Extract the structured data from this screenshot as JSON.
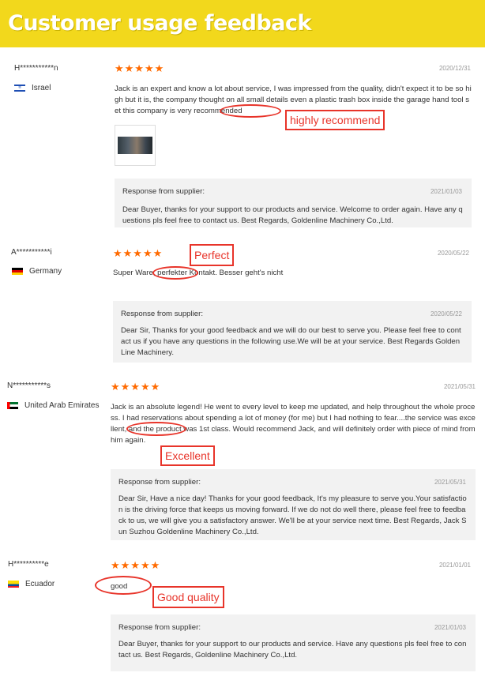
{
  "banner": {
    "title": "Customer usage feedback"
  },
  "stars": "★★★★★",
  "reviews": [
    {
      "user": "H***********n",
      "country": "Israel",
      "flag_icon": "israel-flag-icon",
      "date": "2020/12/31",
      "text": "Jack is an expert and know a lot about service, I was impressed from the quality, didn't expect it to be so high but it is, the company thought on all small details even a plastic trash box inside the garage hand tool set this company is very recommended",
      "annotation": "highly recommend",
      "response_title": "Response from supplier:",
      "response_date": "2021/01/03",
      "response_text": "Dear Buyer, thanks for your support to our products and service. Welcome to order again. Have any questions pls feel free to contact us. Best Regards, Goldenline Machinery Co.,Ltd."
    },
    {
      "user": "A***********i",
      "country": "Germany",
      "flag_icon": "germany-flag-icon",
      "date": "2020/05/22",
      "text": "Super Ware, perfekter Kontakt. Besser geht's nicht",
      "annotation": "Perfect",
      "response_title": "Response from supplier:",
      "response_date": "2020/05/22",
      "response_text": "Dear Sir,   Thanks for your good feedback and we will do our best to serve you. Please feel free to contact us if you have any questions in the following use.We will be at your service. Best Regards GoldenLine Machinery."
    },
    {
      "user": "N***********s",
      "country": "United Arab Emirates",
      "flag_icon": "uae-flag-icon",
      "date": "2021/05/31",
      "text": "Jack is an absolute legend! He went to every level to keep me updated, and help throughout the whole process. I had reservations about spending a lot of money (for me) but I had nothing to fear....the service was excellent, and the product was 1st class. Would recommend Jack, and will definitely order with piece of mind from him again.",
      "annotation": "Excellent",
      "response_title": "Response from supplier:",
      "response_date": "2021/05/31",
      "response_text": "Dear Sir, Have a nice day! Thanks for your good feedback, It's my pleasure to serve you.Your satisfaction is the driving force that keeps us moving forward. If we do not do well there, please feel free to feedback to us, we will give you a satisfactory answer. We'll be at your service next time. Best Regards, Jack Sun Suzhou Goldenline Machinery Co.,Ltd."
    },
    {
      "user": "H**********e",
      "country": "Ecuador",
      "flag_icon": "ecuador-flag-icon",
      "date": "2021/01/01",
      "text": "good",
      "annotation": "Good quality",
      "response_title": "Response from supplier:",
      "response_date": "2021/01/03",
      "response_text": "Dear Buyer, thanks for your support to our products and service. Have any questions pls feel free to contact us. Best Regards, Goldenline Machinery Co.,Ltd."
    }
  ]
}
